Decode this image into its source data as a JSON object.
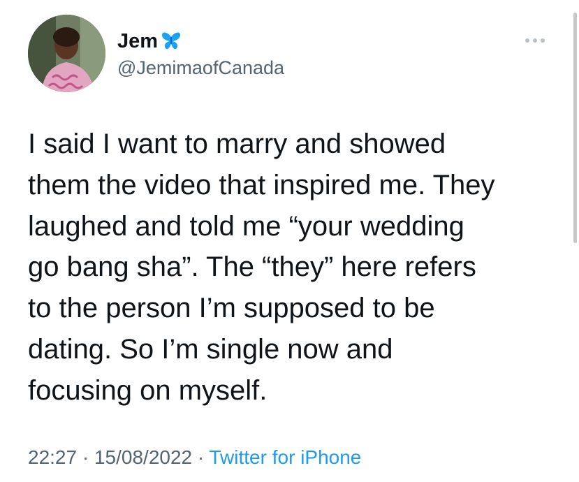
{
  "user": {
    "display_name": "Jem",
    "badge_icon": "butterfly-icon",
    "handle": "@JemimaofCanada"
  },
  "tweet": {
    "lines": [
      "I said I want to marry and showed",
      "them the video that inspired me. They",
      "laughed and told me “your wedding",
      "go bang sha”. The “they” here refers",
      "to the person I’m supposed to be",
      "dating. So I’m single now and",
      "focusing on myself."
    ]
  },
  "meta": {
    "time": "22:27",
    "separator": " · ",
    "date": "15/08/2022",
    "source": "Twitter for iPhone"
  },
  "colors": {
    "text": "#0f1419",
    "secondary": "#536471",
    "link": "#1d9bf0",
    "badge": "#1da1f2"
  }
}
